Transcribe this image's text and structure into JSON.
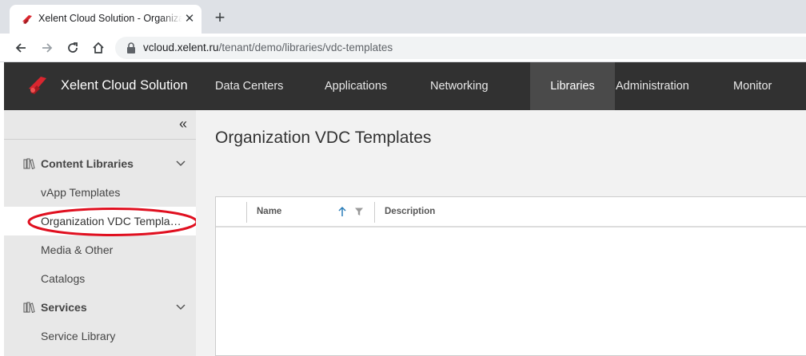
{
  "browser": {
    "tab_title": "Xelent Cloud Solution - Organization VDC Templates",
    "close_glyph": "✕",
    "new_tab_glyph": "+",
    "url_host": "vcloud.xelent.ru",
    "url_path": "/tenant/demo/libraries/vdc-templates"
  },
  "header": {
    "brand": "Xelent Cloud Solution",
    "nav": [
      {
        "label": "Data Centers"
      },
      {
        "label": "Applications"
      },
      {
        "label": "Networking"
      },
      {
        "label": "Libraries"
      },
      {
        "label": "Administration"
      },
      {
        "label": "Monitor"
      }
    ],
    "active_nav": "Libraries"
  },
  "sidebar": {
    "collapse_glyph": "«",
    "groups": [
      {
        "label": "Content Libraries",
        "items": [
          "vApp Templates",
          "Organization VDC Templates",
          "Media & Other",
          "Catalogs"
        ]
      },
      {
        "label": "Services",
        "items": [
          "Service Library"
        ]
      }
    ],
    "active_item": "Organization VDC Templates"
  },
  "main": {
    "title": "Organization VDC Templates",
    "columns": [
      {
        "label": "Name"
      },
      {
        "label": "Description"
      }
    ]
  },
  "colors": {
    "header_bg": "#313131",
    "brand_red": "#d9262f",
    "annotation_red": "#e01020",
    "sort_arrow": "#2a7db8"
  }
}
